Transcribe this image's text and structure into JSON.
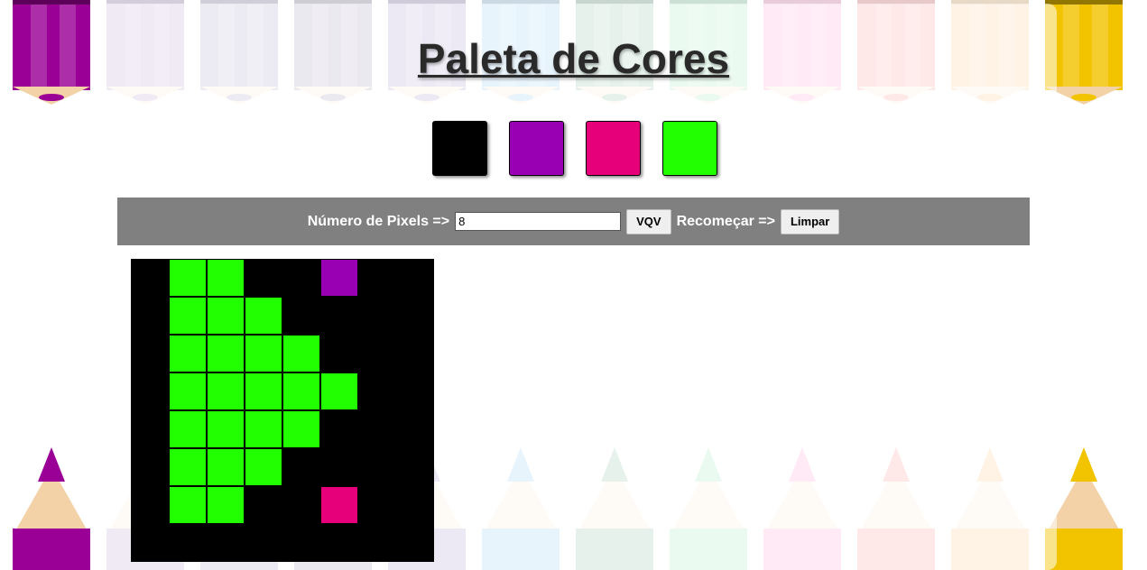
{
  "title": "Paleta de Cores",
  "palette": [
    {
      "name": "black",
      "color": "#000000"
    },
    {
      "name": "purple",
      "color": "#9900b3"
    },
    {
      "name": "magenta",
      "color": "#e6007a"
    },
    {
      "name": "green",
      "color": "#22ff00"
    }
  ],
  "controls": {
    "size_label": "Número de Pixels =>",
    "size_value": "8",
    "vqv_button": "VQV",
    "reset_label": "Recomeçar =>",
    "clear_button": "Limpar"
  },
  "board": {
    "size": 8,
    "background_color": "#000000",
    "pixels": [
      ".GG..P..",
      ".GGG....",
      ".GGGG...",
      ".GGGGG..",
      ".GGGG...",
      ".GGG....",
      ".GG..M..",
      "........"
    ],
    "legend": {
      "G": "#22ff00",
      "P": "#9900b3",
      "M": "#e6007a"
    }
  },
  "background_pencils": {
    "top_colors": [
      "#9b0096",
      "#6a2f9e",
      "#4b3b8c",
      "#3d2b6e",
      "#4a2a9a",
      "#1e90e6",
      "#0a7a3a",
      "#2ecc71",
      "#ff2fa8",
      "#ff1a1a",
      "#ff8c00",
      "#f2c400"
    ],
    "bottom_colors": [
      "#9b0096",
      "#6a2f9e",
      "#4b3b8c",
      "#3d2b6e",
      "#4a2a9a",
      "#1e90e6",
      "#0a7a3a",
      "#2ecc71",
      "#ff2fa8",
      "#ff1a1a",
      "#ff8c00",
      "#f2c400"
    ]
  }
}
